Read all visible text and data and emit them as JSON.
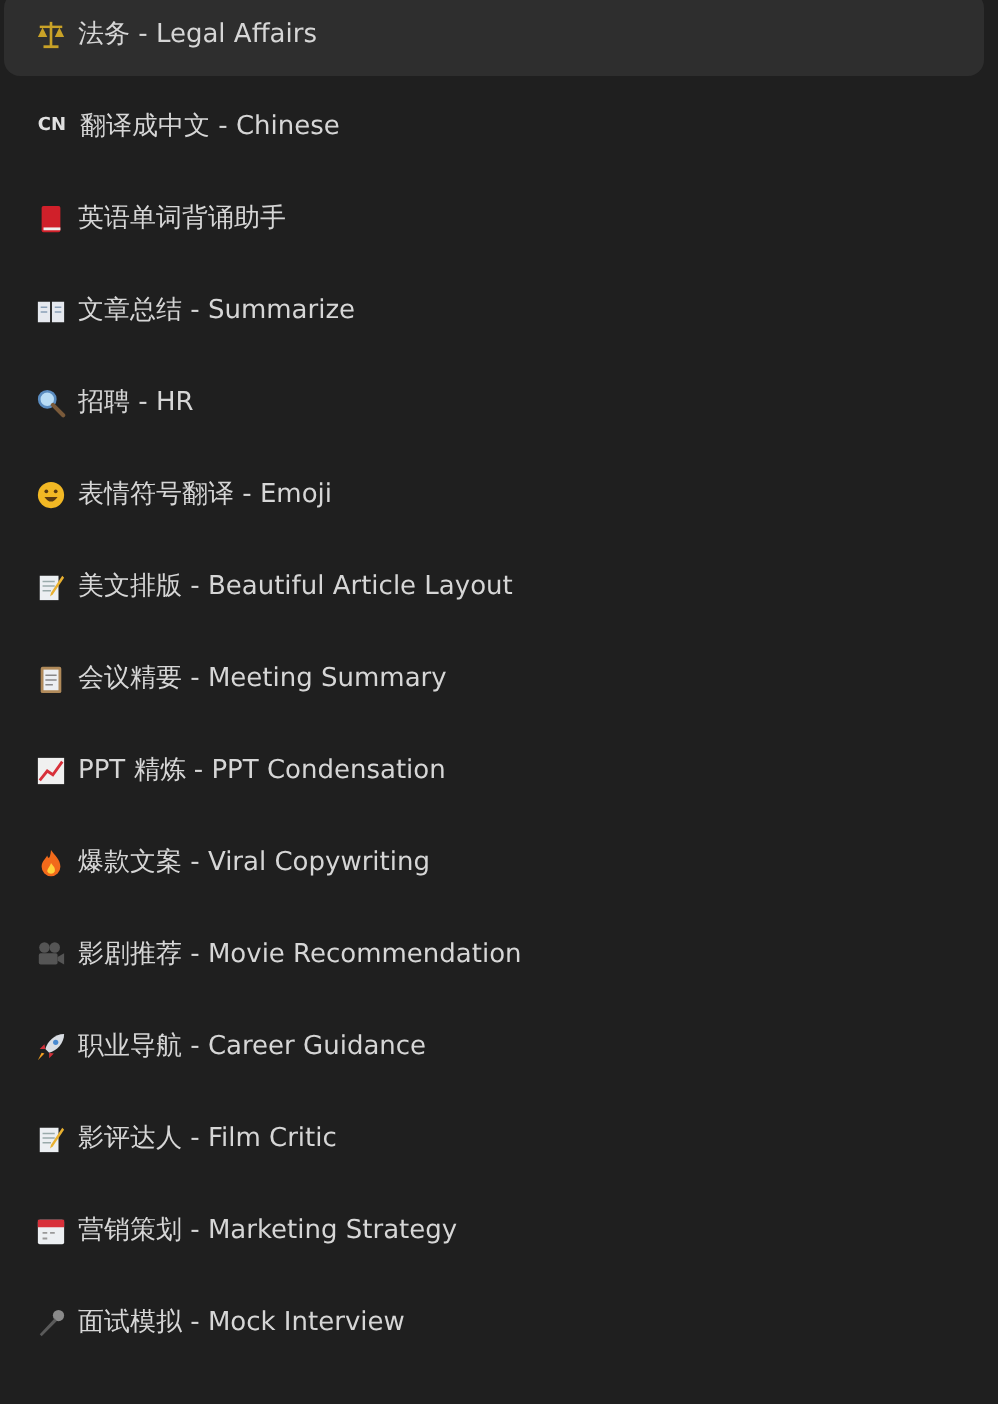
{
  "menu": {
    "items": [
      {
        "kind": "scales",
        "label": "法务 - Legal Affairs",
        "selected": true
      },
      {
        "kind": "letters",
        "badge": "CN",
        "label": "翻译成中文 - Chinese",
        "selected": false
      },
      {
        "kind": "red-book",
        "label": "英语单词背诵助手",
        "selected": false
      },
      {
        "kind": "open-book",
        "label": "文章总结 - Summarize",
        "selected": false
      },
      {
        "kind": "magnifier",
        "label": "招聘 - HR",
        "selected": false
      },
      {
        "kind": "smiley",
        "label": "表情符号翻译 - Emoji",
        "selected": false
      },
      {
        "kind": "memo",
        "label": "美文排版 - Beautiful Article Layout",
        "selected": false
      },
      {
        "kind": "clipboard",
        "label": "会议精要 - Meeting Summary",
        "selected": false
      },
      {
        "kind": "chart",
        "label": "PPT 精炼 - PPT Condensation",
        "selected": false
      },
      {
        "kind": "fire",
        "label": "爆款文案 - Viral Copywriting",
        "selected": false
      },
      {
        "kind": "camera",
        "label": "影剧推荐 - Movie Recommendation",
        "selected": false
      },
      {
        "kind": "rocket",
        "label": "职业导航 - Career Guidance",
        "selected": false
      },
      {
        "kind": "memo",
        "label": "影评达人 - Film Critic",
        "selected": false
      },
      {
        "kind": "calendar",
        "label": "营销策划 - Marketing Strategy",
        "selected": false
      },
      {
        "kind": "microphone",
        "label": "面试模拟 - Mock Interview",
        "selected": false
      }
    ]
  }
}
